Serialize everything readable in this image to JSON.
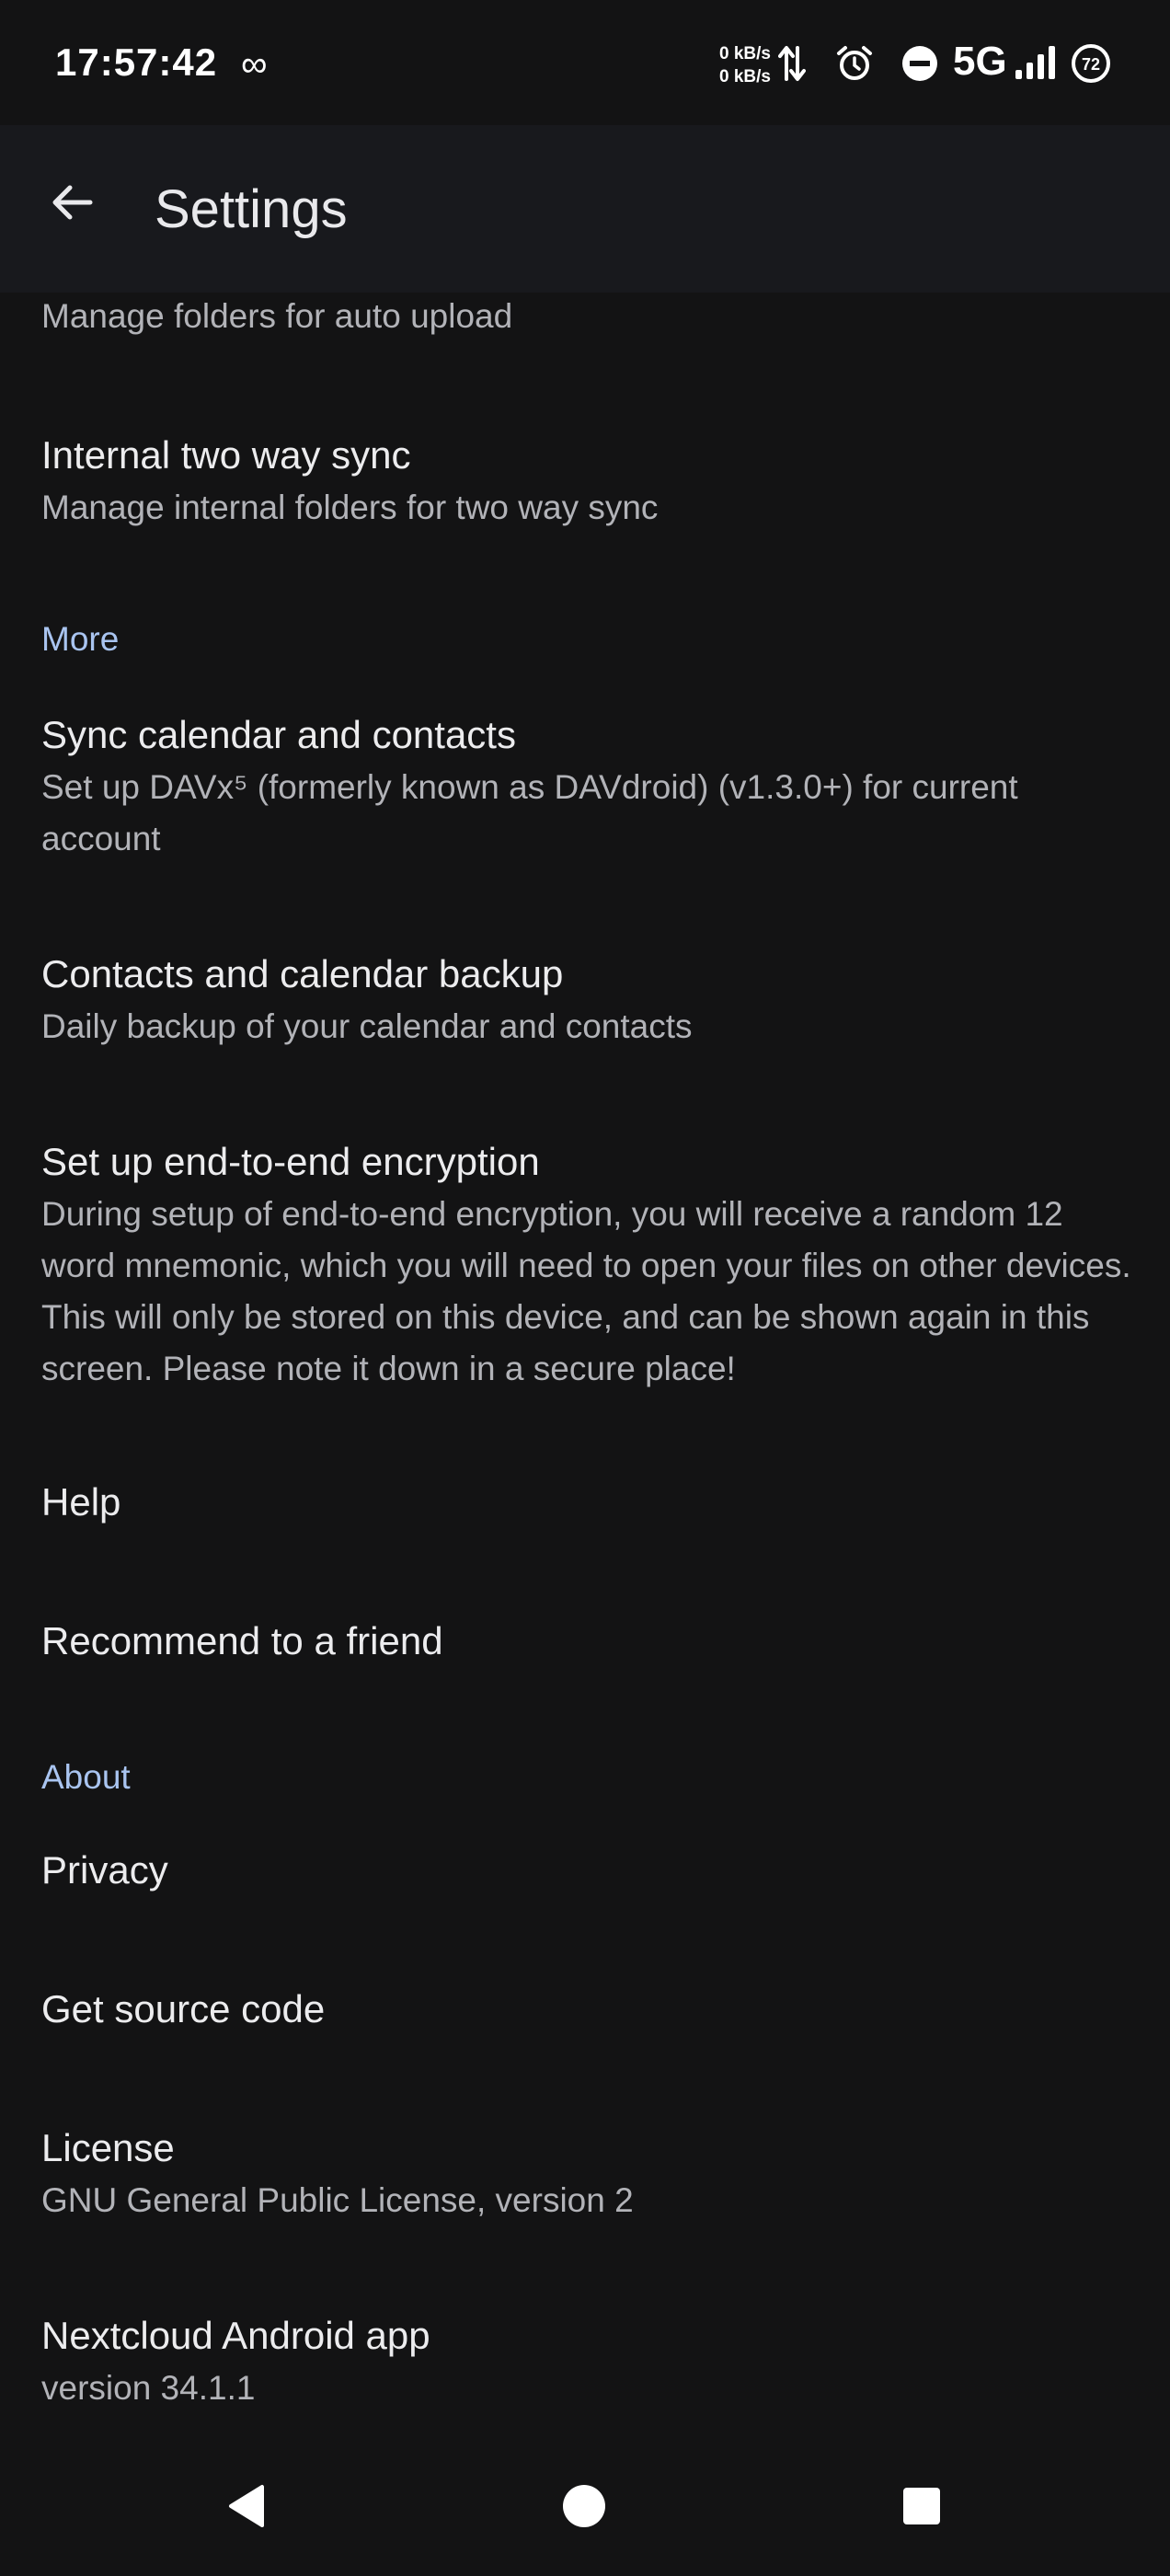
{
  "status_bar": {
    "time": "17:57:42",
    "infinity_glyph": "∞",
    "upload_speed": "0 kB/s",
    "download_speed": "0 kB/s",
    "network": "5G",
    "battery": "72",
    "icons": [
      "infinity-icon",
      "data-transfer-icon",
      "alarm-icon",
      "do-not-disturb-icon",
      "signal-icon",
      "battery-icon"
    ]
  },
  "app_bar": {
    "title": "Settings"
  },
  "list": {
    "partial_summary": "Manage folders for auto upload",
    "internal_sync": {
      "title": "Internal two way sync",
      "summary": "Manage internal folders for two way sync"
    },
    "section_more": "More",
    "sync_calendar": {
      "title": "Sync calendar and contacts",
      "summary": "Set up DAVx⁵ (formerly known as DAVdroid) (v1.3.0+) for current account"
    },
    "contacts_backup": {
      "title": "Contacts and calendar backup",
      "summary": "Daily backup of your calendar and contacts"
    },
    "e2e": {
      "title": "Set up end-to-end encryption",
      "summary": "During setup of end-to-end encryption, you will receive a random 12 word mnemonic, which you will need to open your files on other devices. This will only be stored on this device, and can be shown again in this screen. Please note it down in a secure place!"
    },
    "help": {
      "title": "Help"
    },
    "recommend": {
      "title": "Recommend to a friend"
    },
    "section_about": "About",
    "privacy": {
      "title": "Privacy"
    },
    "source_code": {
      "title": "Get source code"
    },
    "license": {
      "title": "License",
      "summary": "GNU General Public License, version 2"
    },
    "app_info": {
      "title": "Nextcloud Android app",
      "summary": "version 34.1.1"
    }
  },
  "colors": {
    "background": "#131314",
    "app_bar": "#18191d",
    "section_header": "#a9c4f0",
    "title_text": "#ececee",
    "summary_text": "#b2b3b8"
  }
}
